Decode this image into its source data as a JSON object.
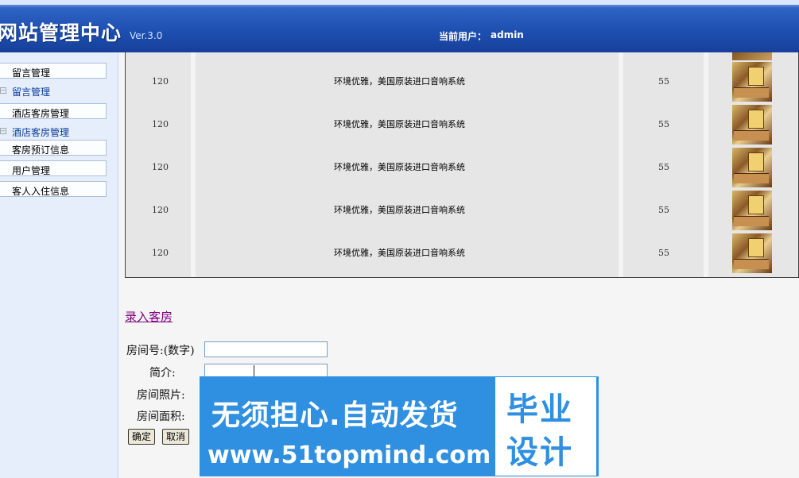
{
  "header": {
    "title": "网站管理中心",
    "version": "Ver.3.0",
    "current_user_label": "当前用户：",
    "current_user": "admin"
  },
  "sidebar": {
    "items": [
      {
        "label": "留言管理",
        "type": "button"
      },
      {
        "label": "留言管理",
        "type": "sub"
      },
      {
        "label": "酒店客房管理",
        "type": "button"
      },
      {
        "label": "酒店客房管理",
        "type": "sub"
      },
      {
        "label": "客房预订信息",
        "type": "button"
      },
      {
        "label": "用户管理",
        "type": "button"
      },
      {
        "label": "客人入住信息",
        "type": "button"
      }
    ]
  },
  "rooms": [
    {
      "price": "120",
      "desc": "环境优雅，美国原装进口音响系统",
      "area": "55"
    },
    {
      "price": "120",
      "desc": "环境优雅，美国原装进口音响系统",
      "area": "55"
    },
    {
      "price": "120",
      "desc": "环境优雅，美国原装进口音响系统",
      "area": "55"
    },
    {
      "price": "120",
      "desc": "环境优雅，美国原装进口音响系统",
      "area": "55"
    },
    {
      "price": "120",
      "desc": "环境优雅，美国原装进口音响系统",
      "area": "55"
    }
  ],
  "form": {
    "add_link": "录入客房",
    "room_number_label": "房间号:(数字)",
    "intro_label": "简介:",
    "photo_label": "房间照片:",
    "area_label": "房间面积:",
    "room_number_value": "",
    "intro_value": "",
    "confirm": "确定",
    "cancel": "取消"
  },
  "watermark": {
    "line1": "无须担心.自动发货",
    "line2": "www.51topmind.com",
    "box1": "毕业",
    "box2": "设计"
  }
}
